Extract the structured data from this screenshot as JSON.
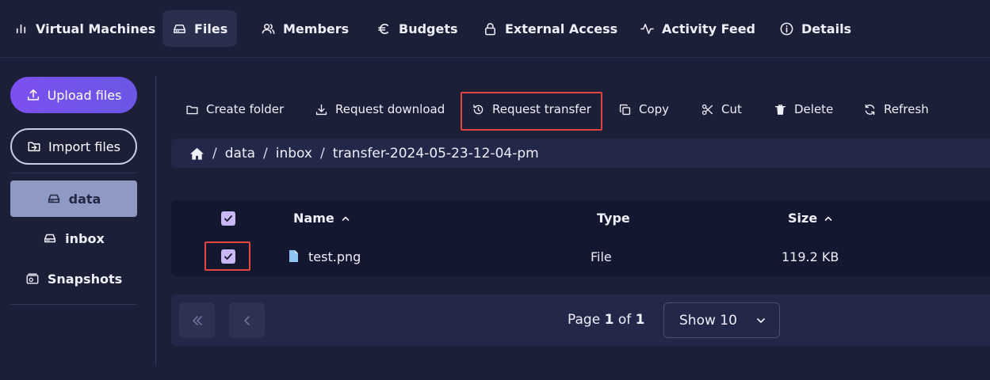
{
  "topnav": {
    "tabs": [
      {
        "label": "Virtual Machines",
        "icon": "bar-chart-icon"
      },
      {
        "label": "Files",
        "icon": "drive-icon",
        "active": true
      },
      {
        "label": "Members",
        "icon": "users-icon"
      },
      {
        "label": "Budgets",
        "icon": "euro-icon"
      },
      {
        "label": "External Access",
        "icon": "lock-icon"
      },
      {
        "label": "Activity Feed",
        "icon": "activity-icon"
      },
      {
        "label": "Details",
        "icon": "info-icon"
      }
    ]
  },
  "sidebar": {
    "upload_label": "Upload files",
    "import_label": "Import files",
    "items": [
      {
        "label": "data",
        "icon": "drive-icon",
        "active": true
      },
      {
        "label": "inbox",
        "icon": "drive-icon"
      },
      {
        "label": "Snapshots",
        "icon": "snapshots-icon"
      }
    ]
  },
  "toolbar": {
    "create_folder": "Create folder",
    "request_download": "Request download",
    "request_transfer": "Request transfer",
    "copy": "Copy",
    "cut": "Cut",
    "delete": "Delete",
    "refresh": "Refresh"
  },
  "breadcrumb": {
    "parts": [
      "data",
      "inbox",
      "transfer-2024-05-23-12-04-pm"
    ],
    "separator": "/"
  },
  "table": {
    "headers": {
      "name": "Name",
      "type": "Type",
      "size": "Size"
    },
    "header_checked": true,
    "rows": [
      {
        "name": "test.png",
        "type": "File",
        "size": "119.2 KB",
        "checked": true
      }
    ]
  },
  "pagination": {
    "page_prefix": "Page",
    "current_page": "1",
    "of_label": "of",
    "total_pages": "1",
    "show_label": "Show 10"
  },
  "colors": {
    "background": "#1c1f38",
    "accent": "#7c4ff0",
    "highlight": "#e0453f",
    "checkbox": "#c9b8f4"
  }
}
